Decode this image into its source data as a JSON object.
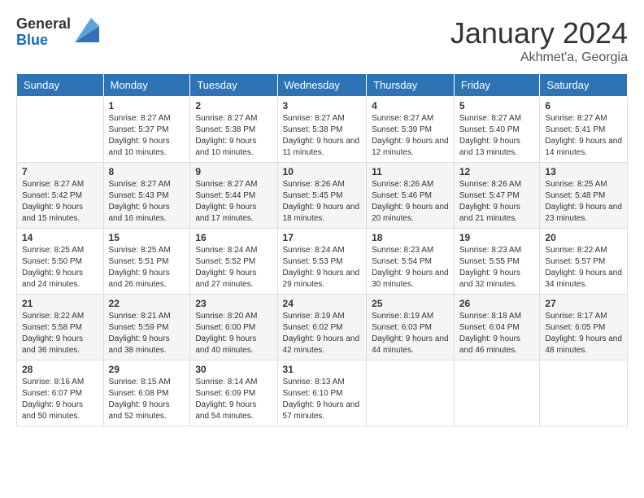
{
  "logo": {
    "general": "General",
    "blue": "Blue"
  },
  "header": {
    "month": "January 2024",
    "location": "Akhmet'a, Georgia"
  },
  "weekdays": [
    "Sunday",
    "Monday",
    "Tuesday",
    "Wednesday",
    "Thursday",
    "Friday",
    "Saturday"
  ],
  "weeks": [
    [
      {
        "day": "",
        "sunrise": "",
        "sunset": "",
        "daylight": ""
      },
      {
        "day": "1",
        "sunrise": "Sunrise: 8:27 AM",
        "sunset": "Sunset: 5:37 PM",
        "daylight": "Daylight: 9 hours and 10 minutes."
      },
      {
        "day": "2",
        "sunrise": "Sunrise: 8:27 AM",
        "sunset": "Sunset: 5:38 PM",
        "daylight": "Daylight: 9 hours and 10 minutes."
      },
      {
        "day": "3",
        "sunrise": "Sunrise: 8:27 AM",
        "sunset": "Sunset: 5:38 PM",
        "daylight": "Daylight: 9 hours and 11 minutes."
      },
      {
        "day": "4",
        "sunrise": "Sunrise: 8:27 AM",
        "sunset": "Sunset: 5:39 PM",
        "daylight": "Daylight: 9 hours and 12 minutes."
      },
      {
        "day": "5",
        "sunrise": "Sunrise: 8:27 AM",
        "sunset": "Sunset: 5:40 PM",
        "daylight": "Daylight: 9 hours and 13 minutes."
      },
      {
        "day": "6",
        "sunrise": "Sunrise: 8:27 AM",
        "sunset": "Sunset: 5:41 PM",
        "daylight": "Daylight: 9 hours and 14 minutes."
      }
    ],
    [
      {
        "day": "7",
        "sunrise": "Sunrise: 8:27 AM",
        "sunset": "Sunset: 5:42 PM",
        "daylight": "Daylight: 9 hours and 15 minutes."
      },
      {
        "day": "8",
        "sunrise": "Sunrise: 8:27 AM",
        "sunset": "Sunset: 5:43 PM",
        "daylight": "Daylight: 9 hours and 16 minutes."
      },
      {
        "day": "9",
        "sunrise": "Sunrise: 8:27 AM",
        "sunset": "Sunset: 5:44 PM",
        "daylight": "Daylight: 9 hours and 17 minutes."
      },
      {
        "day": "10",
        "sunrise": "Sunrise: 8:26 AM",
        "sunset": "Sunset: 5:45 PM",
        "daylight": "Daylight: 9 hours and 18 minutes."
      },
      {
        "day": "11",
        "sunrise": "Sunrise: 8:26 AM",
        "sunset": "Sunset: 5:46 PM",
        "daylight": "Daylight: 9 hours and 20 minutes."
      },
      {
        "day": "12",
        "sunrise": "Sunrise: 8:26 AM",
        "sunset": "Sunset: 5:47 PM",
        "daylight": "Daylight: 9 hours and 21 minutes."
      },
      {
        "day": "13",
        "sunrise": "Sunrise: 8:25 AM",
        "sunset": "Sunset: 5:48 PM",
        "daylight": "Daylight: 9 hours and 23 minutes."
      }
    ],
    [
      {
        "day": "14",
        "sunrise": "Sunrise: 8:25 AM",
        "sunset": "Sunset: 5:50 PM",
        "daylight": "Daylight: 9 hours and 24 minutes."
      },
      {
        "day": "15",
        "sunrise": "Sunrise: 8:25 AM",
        "sunset": "Sunset: 5:51 PM",
        "daylight": "Daylight: 9 hours and 26 minutes."
      },
      {
        "day": "16",
        "sunrise": "Sunrise: 8:24 AM",
        "sunset": "Sunset: 5:52 PM",
        "daylight": "Daylight: 9 hours and 27 minutes."
      },
      {
        "day": "17",
        "sunrise": "Sunrise: 8:24 AM",
        "sunset": "Sunset: 5:53 PM",
        "daylight": "Daylight: 9 hours and 29 minutes."
      },
      {
        "day": "18",
        "sunrise": "Sunrise: 8:23 AM",
        "sunset": "Sunset: 5:54 PM",
        "daylight": "Daylight: 9 hours and 30 minutes."
      },
      {
        "day": "19",
        "sunrise": "Sunrise: 8:23 AM",
        "sunset": "Sunset: 5:55 PM",
        "daylight": "Daylight: 9 hours and 32 minutes."
      },
      {
        "day": "20",
        "sunrise": "Sunrise: 8:22 AM",
        "sunset": "Sunset: 5:57 PM",
        "daylight": "Daylight: 9 hours and 34 minutes."
      }
    ],
    [
      {
        "day": "21",
        "sunrise": "Sunrise: 8:22 AM",
        "sunset": "Sunset: 5:58 PM",
        "daylight": "Daylight: 9 hours and 36 minutes."
      },
      {
        "day": "22",
        "sunrise": "Sunrise: 8:21 AM",
        "sunset": "Sunset: 5:59 PM",
        "daylight": "Daylight: 9 hours and 38 minutes."
      },
      {
        "day": "23",
        "sunrise": "Sunrise: 8:20 AM",
        "sunset": "Sunset: 6:00 PM",
        "daylight": "Daylight: 9 hours and 40 minutes."
      },
      {
        "day": "24",
        "sunrise": "Sunrise: 8:19 AM",
        "sunset": "Sunset: 6:02 PM",
        "daylight": "Daylight: 9 hours and 42 minutes."
      },
      {
        "day": "25",
        "sunrise": "Sunrise: 8:19 AM",
        "sunset": "Sunset: 6:03 PM",
        "daylight": "Daylight: 9 hours and 44 minutes."
      },
      {
        "day": "26",
        "sunrise": "Sunrise: 8:18 AM",
        "sunset": "Sunset: 6:04 PM",
        "daylight": "Daylight: 9 hours and 46 minutes."
      },
      {
        "day": "27",
        "sunrise": "Sunrise: 8:17 AM",
        "sunset": "Sunset: 6:05 PM",
        "daylight": "Daylight: 9 hours and 48 minutes."
      }
    ],
    [
      {
        "day": "28",
        "sunrise": "Sunrise: 8:16 AM",
        "sunset": "Sunset: 6:07 PM",
        "daylight": "Daylight: 9 hours and 50 minutes."
      },
      {
        "day": "29",
        "sunrise": "Sunrise: 8:15 AM",
        "sunset": "Sunset: 6:08 PM",
        "daylight": "Daylight: 9 hours and 52 minutes."
      },
      {
        "day": "30",
        "sunrise": "Sunrise: 8:14 AM",
        "sunset": "Sunset: 6:09 PM",
        "daylight": "Daylight: 9 hours and 54 minutes."
      },
      {
        "day": "31",
        "sunrise": "Sunrise: 8:13 AM",
        "sunset": "Sunset: 6:10 PM",
        "daylight": "Daylight: 9 hours and 57 minutes."
      },
      {
        "day": "",
        "sunrise": "",
        "sunset": "",
        "daylight": ""
      },
      {
        "day": "",
        "sunrise": "",
        "sunset": "",
        "daylight": ""
      },
      {
        "day": "",
        "sunrise": "",
        "sunset": "",
        "daylight": ""
      }
    ]
  ]
}
